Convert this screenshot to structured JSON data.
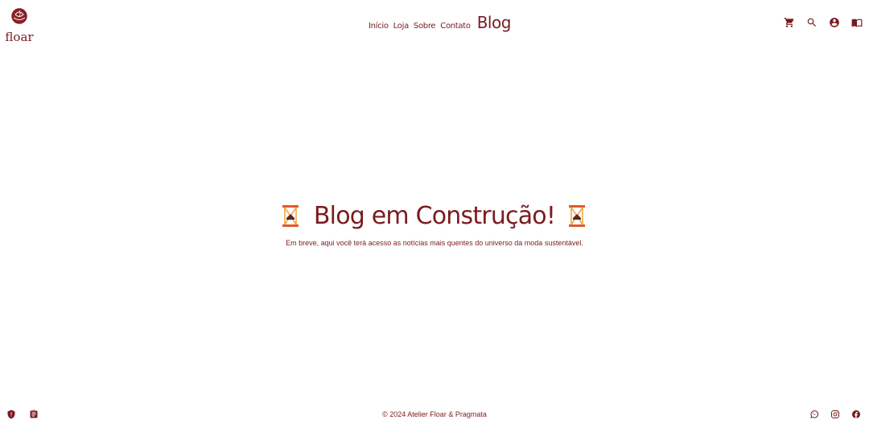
{
  "brand": {
    "name": "floar"
  },
  "nav": {
    "items": [
      {
        "label": "Início"
      },
      {
        "label": "Loja"
      },
      {
        "label": "Sobre"
      },
      {
        "label": "Contato"
      },
      {
        "label": "Blog"
      }
    ],
    "active": "Blog"
  },
  "header_icons": [
    "cart-icon",
    "search-icon",
    "account-icon",
    "book-icon"
  ],
  "main": {
    "title": "Blog em Construção!",
    "subtitle": "Em breve, aqui você terá acesso as notícias mais quentes do universo da moda sustentável."
  },
  "footer": {
    "copyright": "© 2024 Atelier Floar & Pragmata",
    "left_icons": [
      "shield-icon",
      "clipboard-icon"
    ],
    "right_icons": [
      "whatsapp-icon",
      "instagram-icon",
      "facebook-icon"
    ]
  },
  "colors": {
    "brand": "#7a1b1f",
    "background": "#ffffff",
    "accent_orange": "#f0a030"
  }
}
